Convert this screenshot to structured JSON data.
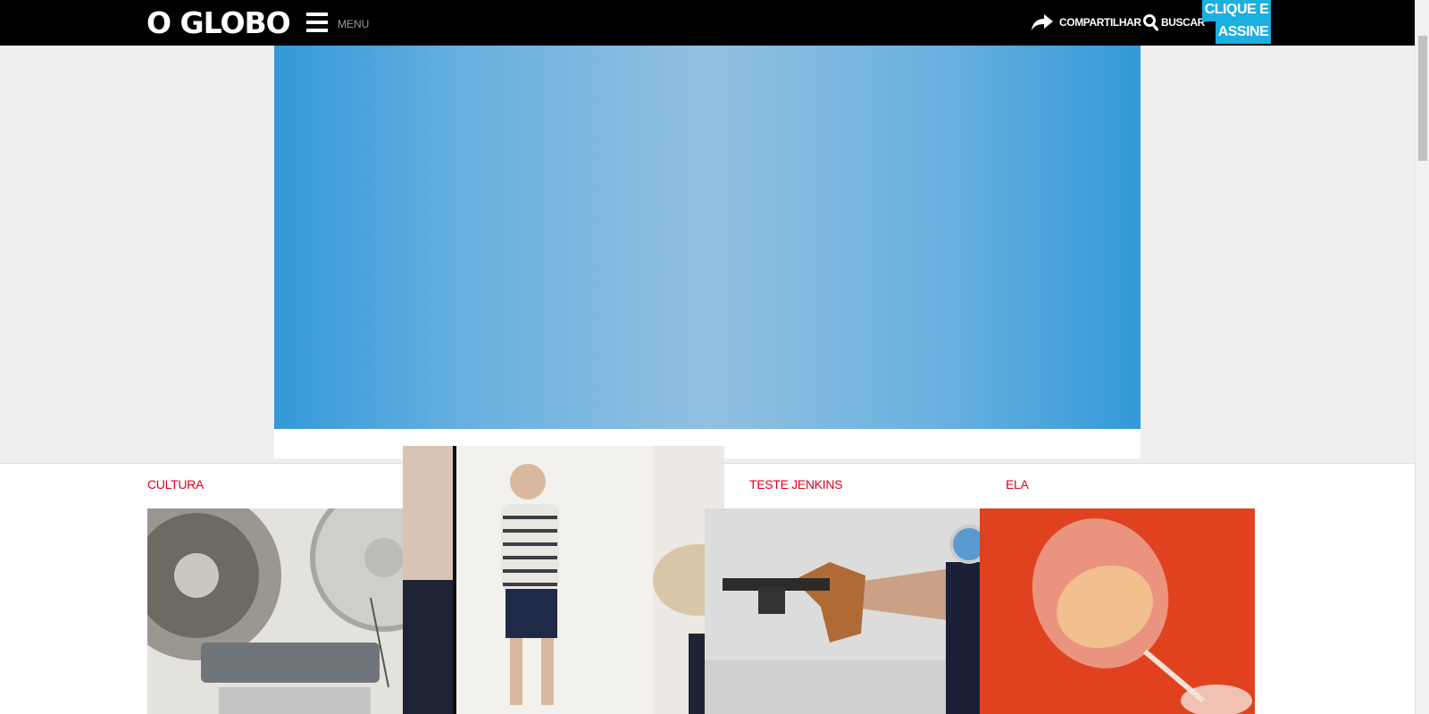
{
  "header": {
    "logo": "O GLOBO",
    "menu_label": "MENU",
    "share_label": "COMPARTILHAR",
    "search_label": "BUSCAR",
    "subscribe_line1": "CLIQUE E",
    "subscribe_line2": "ASSINE"
  },
  "sections": [
    {
      "label": "CULTURA"
    },
    {
      "label": "TESTE JENKINS"
    },
    {
      "label": "ELA"
    }
  ],
  "colors": {
    "topbar": "#000000",
    "accent_subscribe": "#1bb0e2",
    "section_label": "#e3001b",
    "hero_blue": "#3399d8"
  },
  "icons": [
    "menu-icon",
    "share-icon",
    "search-icon"
  ]
}
